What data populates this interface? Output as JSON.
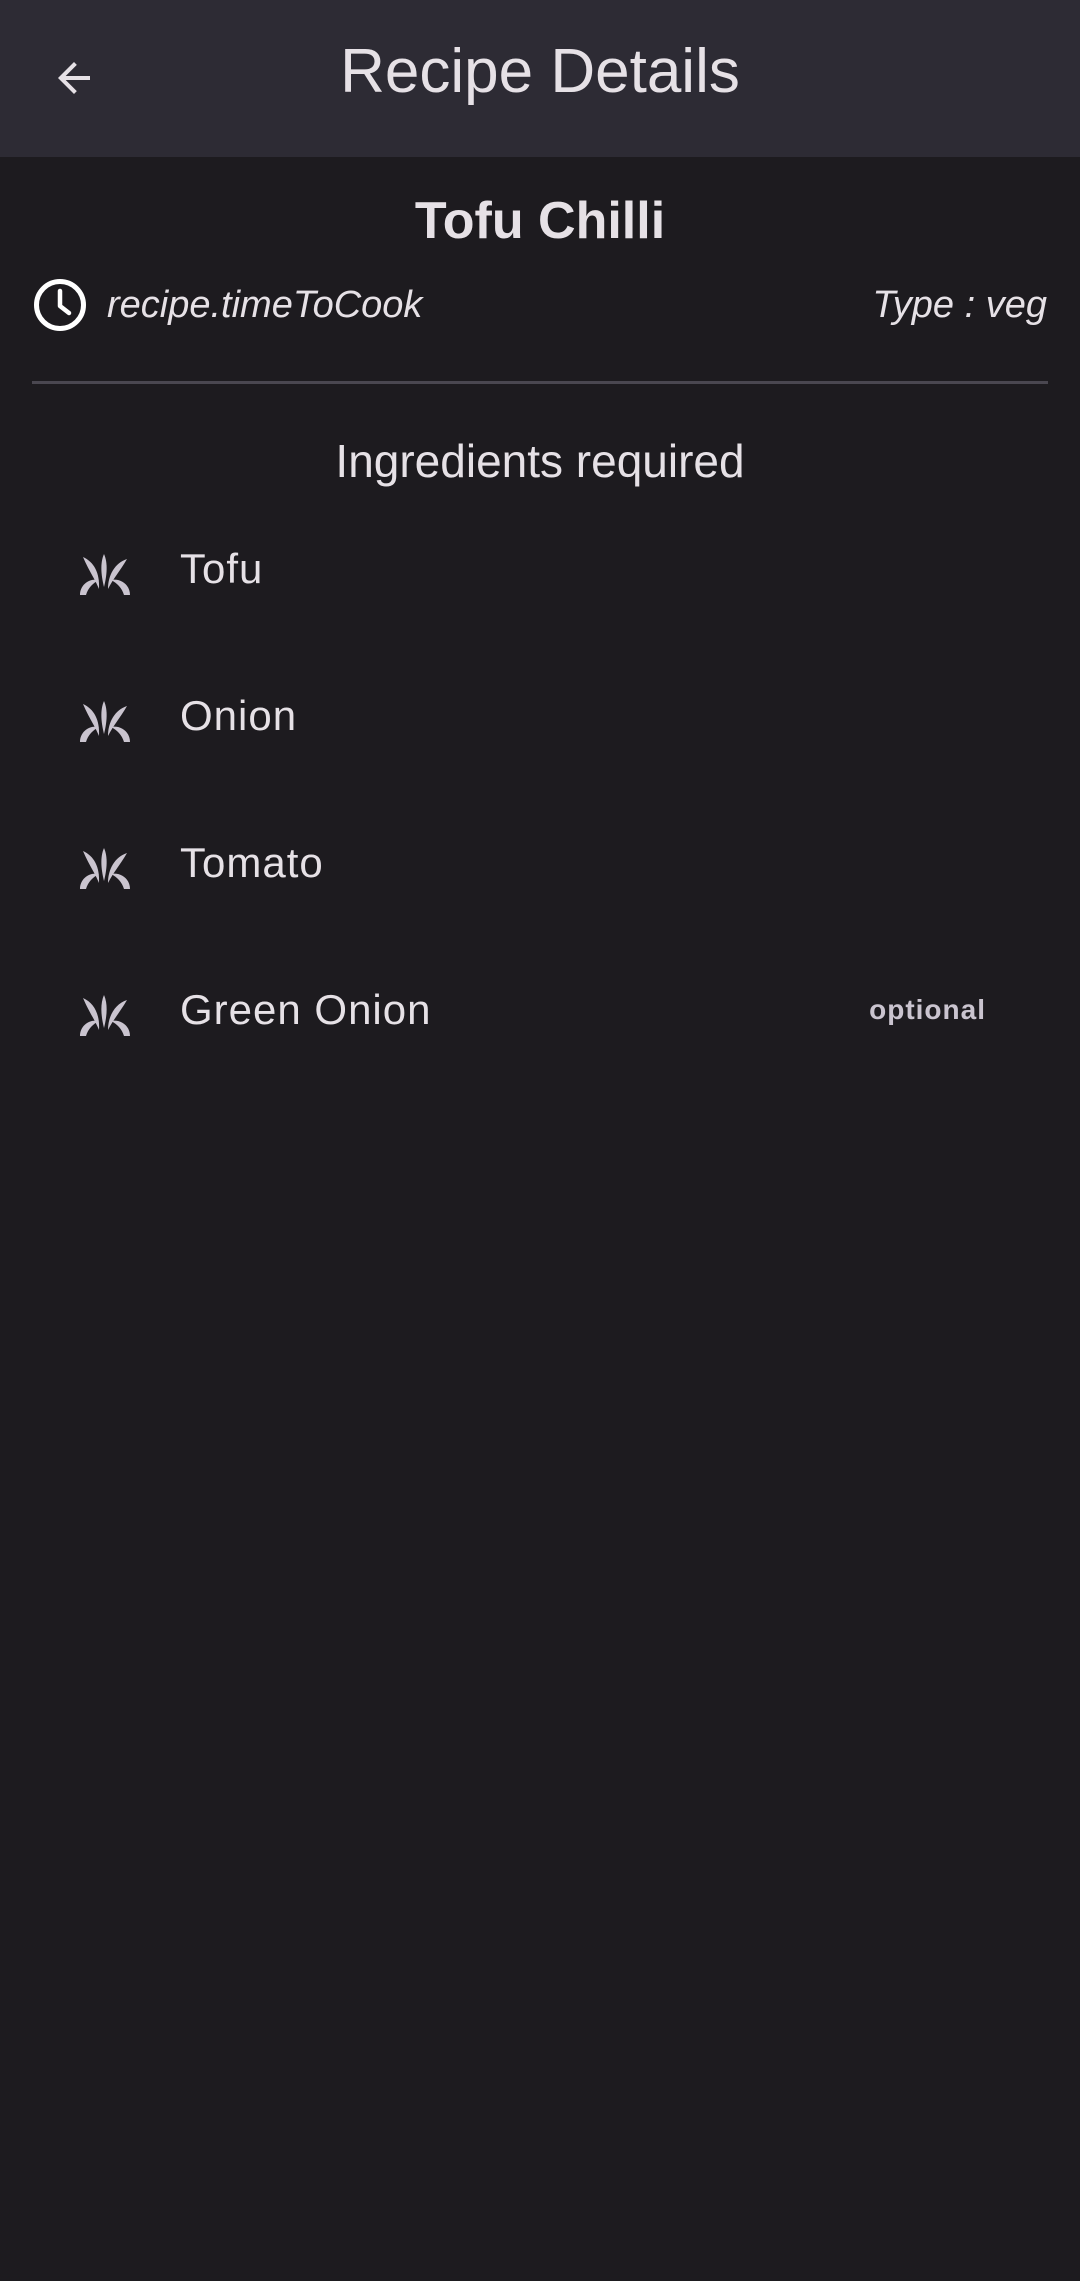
{
  "app_bar": {
    "title": "Recipe Details",
    "back_icon": "arrow-left-icon"
  },
  "recipe": {
    "name": "Tofu Chilli",
    "time_icon": "clock-icon",
    "time_to_cook": "recipe.timeToCook",
    "type": "Type : veg"
  },
  "ingredients": {
    "heading": "Ingredients required",
    "icon": "sprout-icon",
    "items": [
      {
        "name": "Tofu",
        "tag": ""
      },
      {
        "name": "Onion",
        "tag": ""
      },
      {
        "name": "Tomato",
        "tag": ""
      },
      {
        "name": "Green Onion",
        "tag": "optional"
      }
    ]
  },
  "colors": {
    "background": "#1d1b1f",
    "app_bar": "#2d2b34",
    "text": "#e6e1e6",
    "icon": "#cac4cf",
    "divider": "#4a4750"
  }
}
